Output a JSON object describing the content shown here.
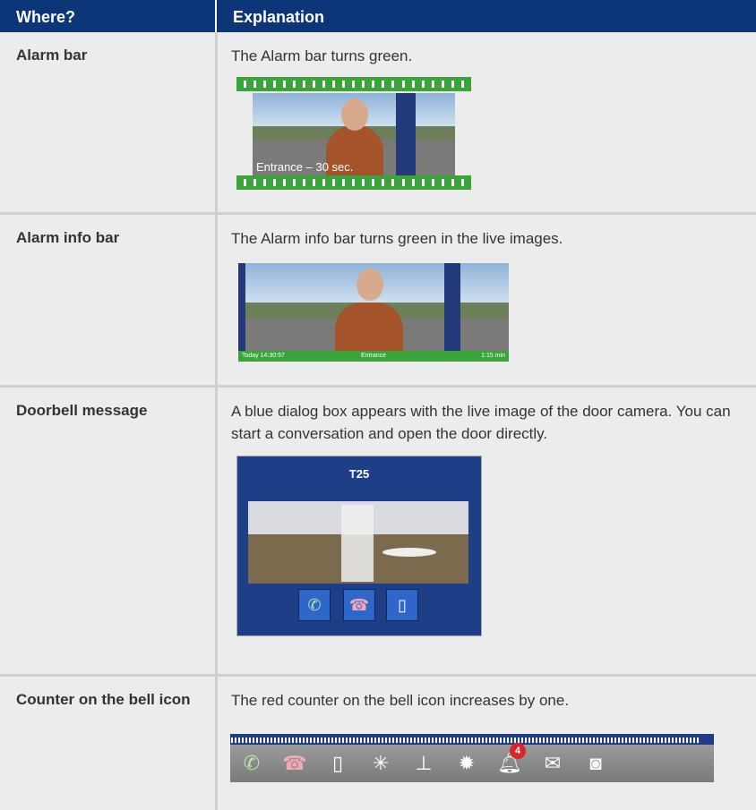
{
  "header": {
    "col1": "Where?",
    "col2": "Explanation"
  },
  "rows": [
    {
      "where": "Alarm bar",
      "explanation": "The Alarm bar turns green.",
      "caption": "Entrance – 30 sec."
    },
    {
      "where": "Alarm info bar",
      "explanation": "The Alarm info bar turns green in the live images.",
      "info_left": "Today 14:30:57",
      "info_center": "Entrance",
      "info_right": "1:15 min"
    },
    {
      "where": "Doorbell message",
      "explanation": "A blue dialog box appears with the live image of the door camera. You can start a conversation and open the door directly.",
      "dialog_title": "T25"
    },
    {
      "where": "Counter on the bell icon",
      "explanation": "The red counter on the bell icon increases by one.",
      "badge_count": "4"
    }
  ],
  "icons": [
    "phone-accept-icon",
    "phone-hangup-icon",
    "door-icon",
    "light-icon",
    "thermometer-icon",
    "alarm-icon",
    "bell-icon",
    "mail-icon",
    "camera-icon"
  ],
  "colors": {
    "header_bg": "#0c3677",
    "alarm_green": "#3aa43a",
    "dialog_blue": "#1e3f88",
    "badge_red": "#d8262c"
  }
}
